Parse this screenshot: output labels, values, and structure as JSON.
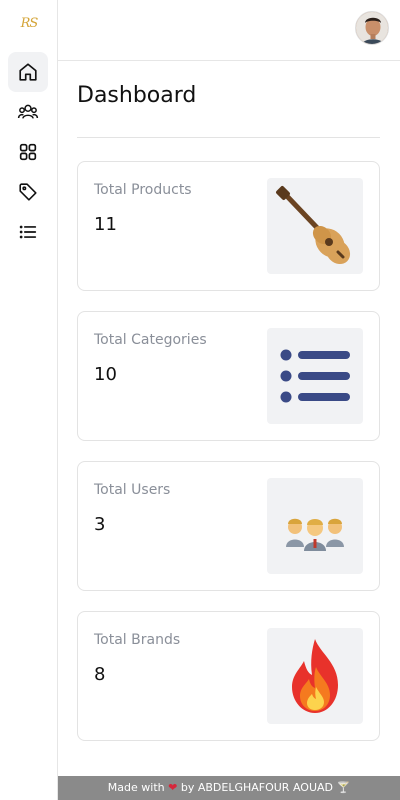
{
  "brand": {
    "logo_text": "RS",
    "accent": "#d4a437"
  },
  "sidebar": {
    "items": [
      {
        "icon": "home-icon",
        "active": true
      },
      {
        "icon": "users-icon",
        "active": false
      },
      {
        "icon": "grid-icon",
        "active": false
      },
      {
        "icon": "tag-icon",
        "active": false
      },
      {
        "icon": "list-icon",
        "active": false
      }
    ]
  },
  "header": {
    "avatar": "user-avatar"
  },
  "main": {
    "title": "Dashboard",
    "cards": [
      {
        "label": "Total Products",
        "value": "11",
        "icon": "guitar-icon"
      },
      {
        "label": "Total Categories",
        "value": "10",
        "icon": "list-icon"
      },
      {
        "label": "Total Users",
        "value": "3",
        "icon": "people-icon"
      },
      {
        "label": "Total Brands",
        "value": "8",
        "icon": "fire-icon"
      }
    ]
  },
  "footer": {
    "prefix": "Made with",
    "heart": "❤",
    "suffix": "by ABDELGHAFOUR AOUAD",
    "trail": "🍸"
  }
}
